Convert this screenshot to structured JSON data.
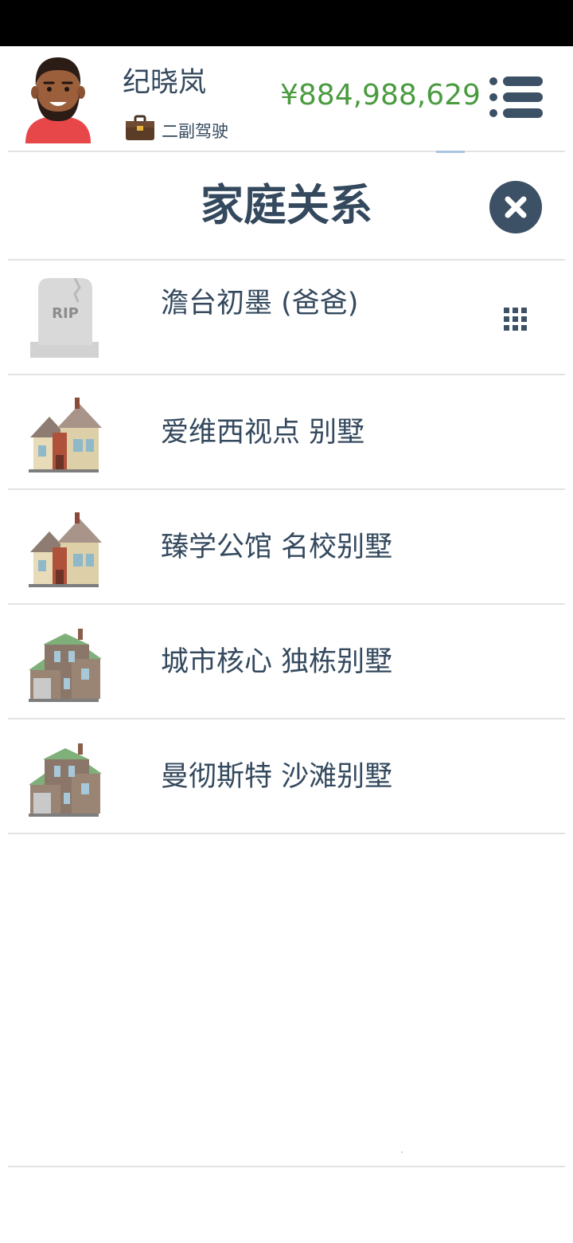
{
  "header": {
    "player_name": "纪晓岚",
    "job_title": "二副驾驶",
    "money": "¥884,988,629",
    "avatar_icon": "man-avatar-icon",
    "job_icon": "briefcase-icon",
    "menu_icon": "list-menu-icon"
  },
  "panel": {
    "title": "家庭关系",
    "close_icon": "close-icon"
  },
  "family": {
    "items": [
      {
        "label": "澹台初墨 (爸爸)",
        "icon": "tombstone-icon",
        "icon_text": "RIP",
        "action_icon": "grid-icon"
      },
      {
        "label": "爱维西视点 别墅",
        "icon": "villa-icon"
      },
      {
        "label": "臻学公馆 名校别墅",
        "icon": "villa-icon"
      },
      {
        "label": "城市核心 独栋别墅",
        "icon": "townhouse-icon"
      },
      {
        "label": "曼彻斯特 沙滩别墅",
        "icon": "townhouse-icon"
      }
    ]
  },
  "colors": {
    "text": "#34495e",
    "money": "#4a9b3f",
    "divider": "#e3e3e3",
    "close_button": "#3d5166"
  }
}
